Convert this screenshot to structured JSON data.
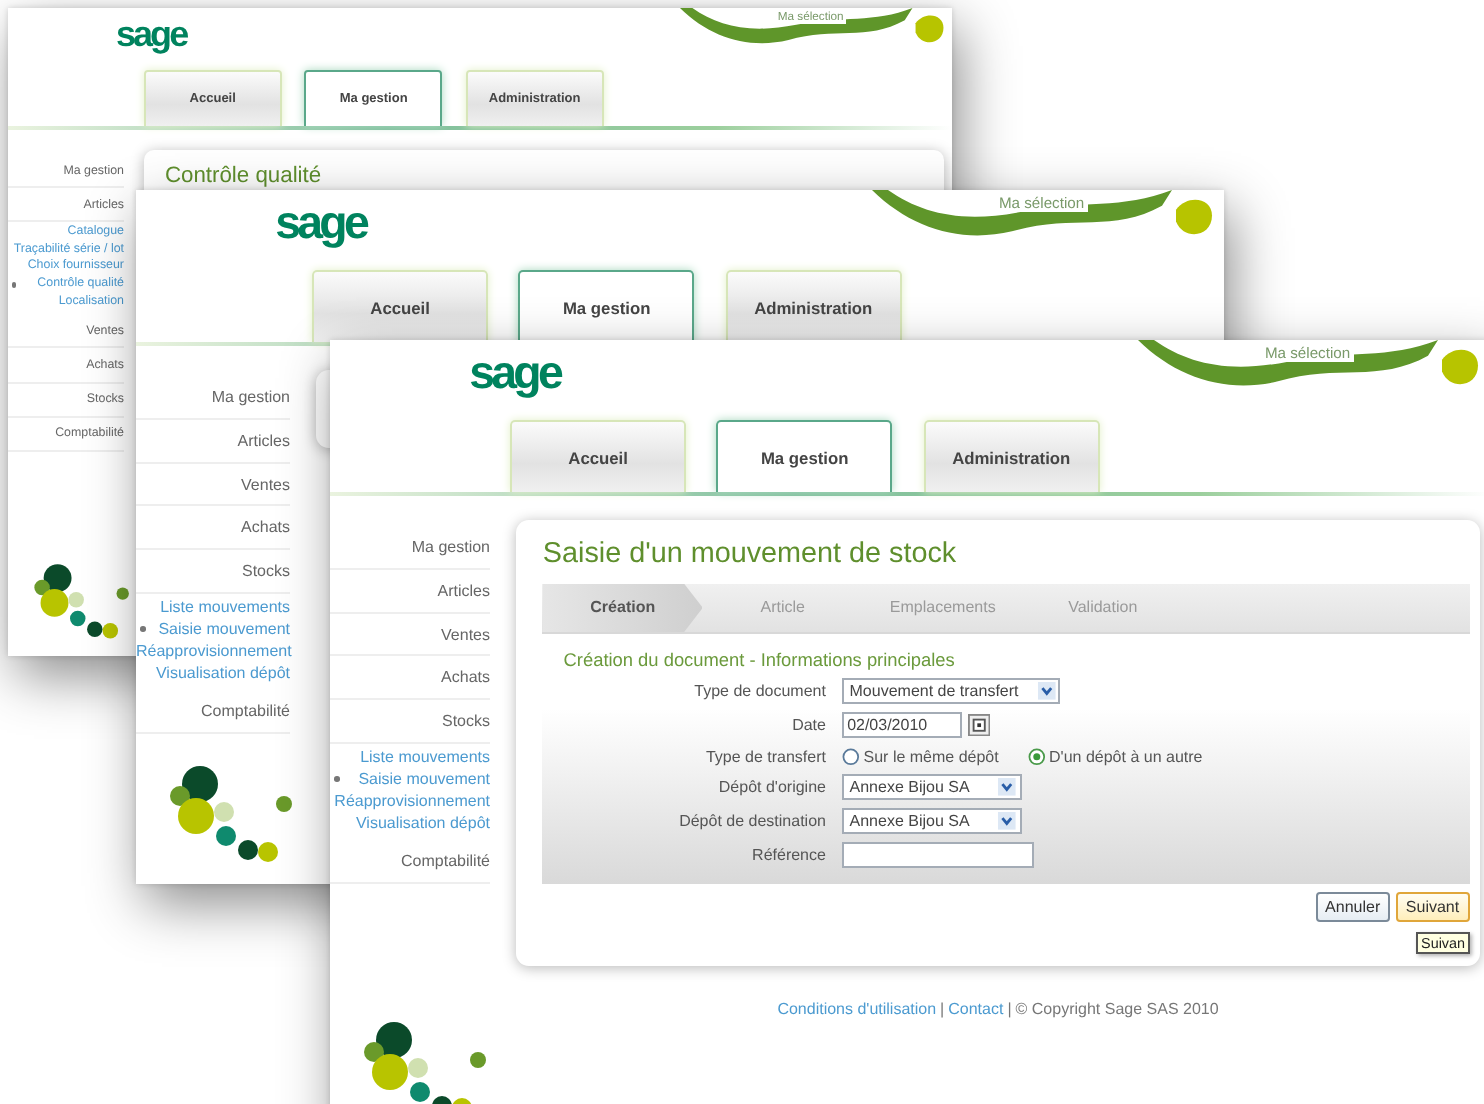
{
  "windows": [
    {
      "logo": "sage",
      "selection_link": "Ma sélection",
      "tabs": [
        {
          "label": "Accueil",
          "selected": false
        },
        {
          "label": "Ma gestion",
          "selected": true
        },
        {
          "label": "Administration",
          "selected": false
        }
      ],
      "sidebar": [
        {
          "label": "Ma gestion"
        },
        {
          "label": "Articles",
          "children": [
            {
              "label": "Catalogue",
              "selected": false
            },
            {
              "label": "Traçabilité série / lot",
              "selected": false
            },
            {
              "label": "Choix fournisseur",
              "selected": false
            },
            {
              "label": "Contrôle qualité",
              "selected": true
            },
            {
              "label": "Localisation",
              "selected": false
            }
          ]
        },
        {
          "label": "Ventes"
        },
        {
          "label": "Achats"
        },
        {
          "label": "Stocks"
        },
        {
          "label": "Comptabilité"
        }
      ],
      "page_title": "Contrôle qualité"
    },
    {
      "logo": "sage",
      "selection_link": "Ma sélection",
      "tabs": [
        {
          "label": "Accueil",
          "selected": false
        },
        {
          "label": "Ma gestion",
          "selected": true
        },
        {
          "label": "Administration",
          "selected": false
        }
      ],
      "sidebar": [
        {
          "label": "Ma gestion"
        },
        {
          "label": "Articles"
        },
        {
          "label": "Ventes"
        },
        {
          "label": "Achats"
        },
        {
          "label": "Stocks",
          "children": [
            {
              "label": "Liste mouvements",
              "selected": false
            },
            {
              "label": "Saisie mouvement",
              "selected": true
            },
            {
              "label": "Réapprovisionnement",
              "selected": false
            },
            {
              "label": "Visualisation dépôt",
              "selected": false
            }
          ]
        },
        {
          "label": "Comptabilité"
        }
      ]
    },
    {
      "logo": "sage",
      "selection_link": "Ma sélection",
      "tabs": [
        {
          "label": "Accueil",
          "selected": false
        },
        {
          "label": "Ma gestion",
          "selected": true
        },
        {
          "label": "Administration",
          "selected": false
        }
      ],
      "sidebar": [
        {
          "label": "Ma gestion"
        },
        {
          "label": "Articles"
        },
        {
          "label": "Ventes"
        },
        {
          "label": "Achats"
        },
        {
          "label": "Stocks",
          "children": [
            {
              "label": "Liste mouvements",
              "selected": false
            },
            {
              "label": "Saisie mouvement",
              "selected": true
            },
            {
              "label": "Réapprovisionnement",
              "selected": false
            },
            {
              "label": "Visualisation dépôt",
              "selected": false
            }
          ]
        },
        {
          "label": "Comptabilité"
        }
      ],
      "page_title": "Saisie d'un mouvement de stock",
      "wizard": {
        "steps": [
          {
            "label": "Création",
            "selected": true
          },
          {
            "label": "Article",
            "selected": false
          },
          {
            "label": "Emplacements",
            "selected": false
          },
          {
            "label": "Validation",
            "selected": false
          }
        ],
        "section_title": "Création du document - Informations principales",
        "fields": [
          {
            "kind": "select",
            "label": "Type de document",
            "value": "Mouvement de transfert"
          },
          {
            "kind": "date",
            "label": "Date",
            "value": "02/03/2010"
          },
          {
            "kind": "radio",
            "label": "Type de transfert",
            "options": [
              {
                "label": "Sur le même dépôt",
                "selected": false
              },
              {
                "label": "D'un dépôt à un autre",
                "selected": true
              }
            ]
          },
          {
            "kind": "select",
            "label": "Dépôt d'origine",
            "value": "Annexe Bijou SA"
          },
          {
            "kind": "select",
            "label": "Dépôt de destination",
            "value": "Annexe Bijou SA"
          },
          {
            "kind": "text",
            "label": "Référence"
          }
        ],
        "buttons": [
          {
            "label": "Annuler",
            "focused": false
          },
          {
            "label": "Suivant",
            "focused": true
          }
        ],
        "tooltip": "Suivan"
      },
      "footer": [
        {
          "kind": "link",
          "text": "Conditions d'utilisation"
        },
        {
          "kind": "separator",
          "text": "|"
        },
        {
          "kind": "link",
          "text": "Contact"
        },
        {
          "kind": "separator",
          "text": "|"
        },
        {
          "kind": "text",
          "text": "© Copyright Sage SAS 2010"
        }
      ]
    }
  ]
}
